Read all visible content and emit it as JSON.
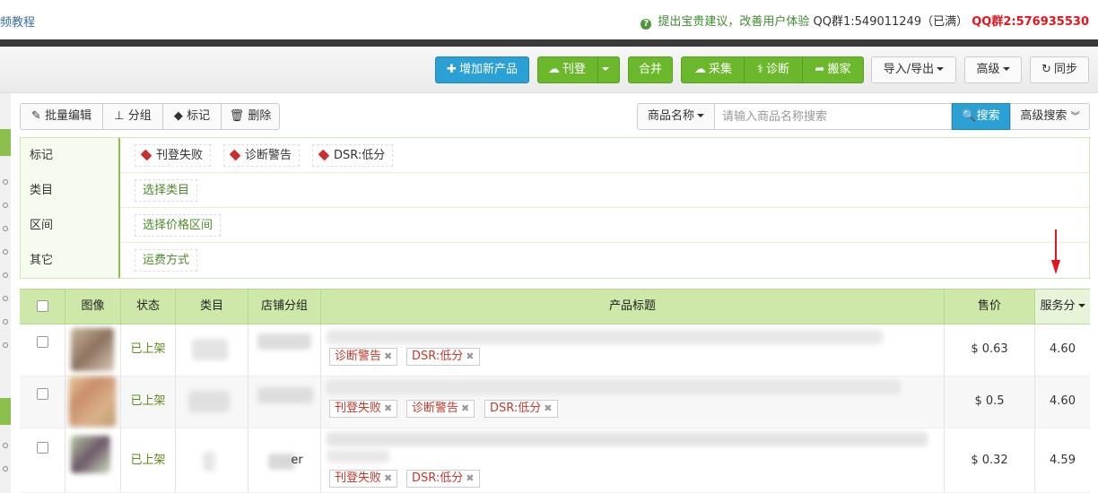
{
  "top": {
    "left_link": "频教程",
    "tip": "提出宝贵建议，改善用户体验",
    "qq1": "QQ群1:549011249（已满）",
    "qq2": "QQ群2:576935530"
  },
  "toolbar": {
    "add_product": "增加新产品",
    "publish": "刊登",
    "merge": "合并",
    "collect": "采集",
    "diagnose": "诊断",
    "move": "搬家",
    "import_export": "导入/导出",
    "advanced": "高级",
    "sync": "同步"
  },
  "actions": {
    "batch_edit": "批量编辑",
    "group": "分组",
    "mark": "标记",
    "delete": "删除"
  },
  "search": {
    "field": "商品名称",
    "placeholder": "请输入商品名称搜索",
    "button": "搜索",
    "advanced": "高级搜索"
  },
  "filters": [
    {
      "label": "标记",
      "chips": [
        "刊登失败",
        "诊断警告",
        "DSR:低分"
      ]
    },
    {
      "label": "类目",
      "chips": [
        "选择类目"
      ]
    },
    {
      "label": "区间",
      "chips": [
        "选择价格区间"
      ]
    },
    {
      "label": "其它",
      "chips": [
        "运费方式"
      ]
    }
  ],
  "table": {
    "headers": [
      "图像",
      "状态",
      "类目",
      "店铺分组",
      "产品标题",
      "售价",
      "服务分"
    ],
    "rows": [
      {
        "status": "已上架",
        "tags": [
          "诊断警告",
          "DSR:低分"
        ],
        "price": "$ 0.63",
        "score": "4.60",
        "group_text": ""
      },
      {
        "status": "已上架",
        "tags": [
          "刊登失败",
          "诊断警告",
          "DSR:低分"
        ],
        "price": "$ 0.5",
        "score": "4.60",
        "group_text": ""
      },
      {
        "status": "已上架",
        "tags": [
          "刊登失败",
          "DSR:低分"
        ],
        "price": "$ 0.32",
        "score": "4.59",
        "group_text": "er"
      }
    ]
  },
  "colors": {
    "primary_blue": "#2aa0d4",
    "green": "#6cb82c",
    "header_green": "#cde8a9",
    "alert_red": "#e5141d"
  }
}
